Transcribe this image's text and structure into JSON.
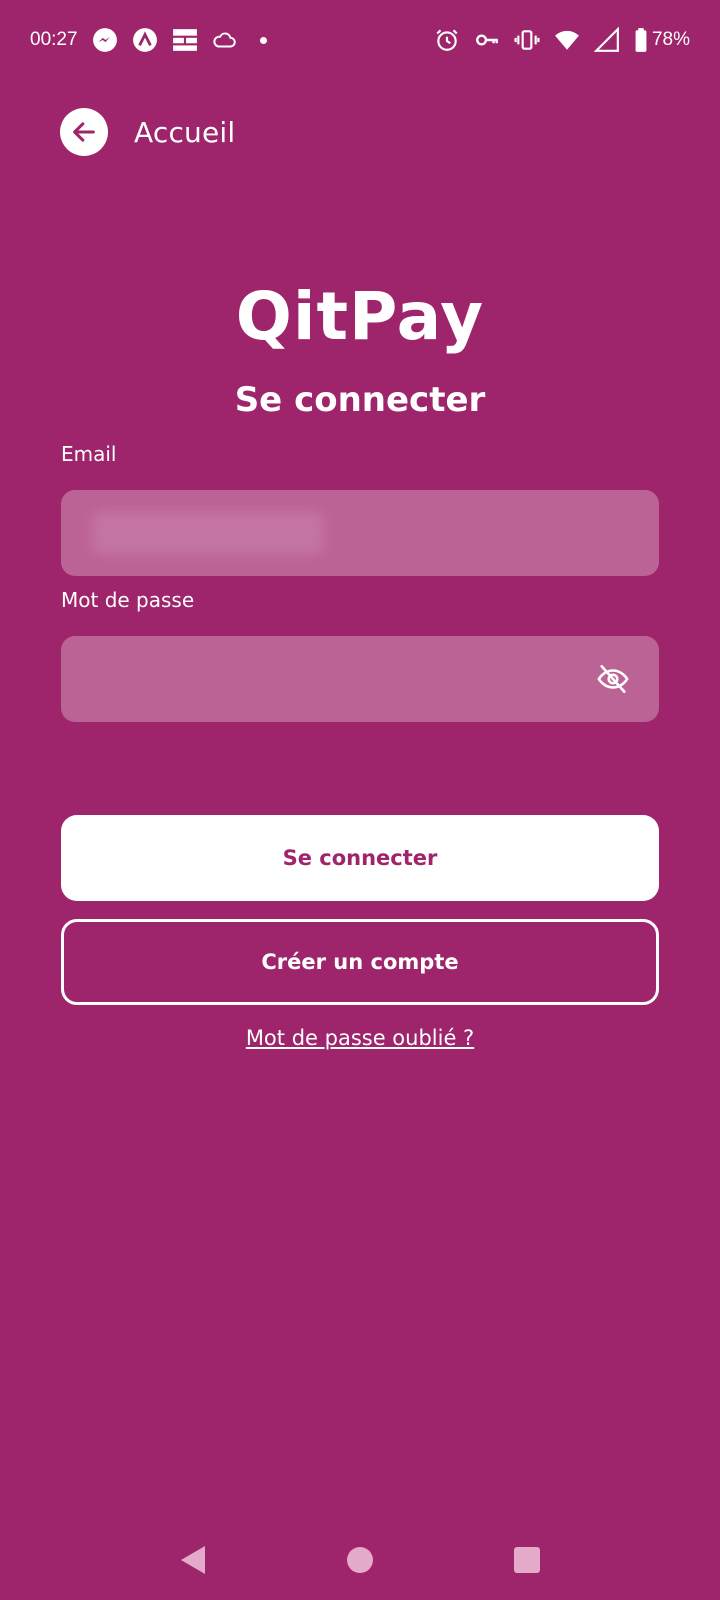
{
  "status_bar": {
    "time": "00:27",
    "battery": "78%",
    "left_icons": [
      "messenger-icon",
      "app-a-icon",
      "grid-icon",
      "cloud-icon"
    ],
    "right_icons": [
      "alarm-icon",
      "vpn-key-icon",
      "vibrate-icon",
      "wifi-icon",
      "signal-icon",
      "battery-icon"
    ]
  },
  "header": {
    "back_label": "Accueil"
  },
  "brand": {
    "logo_text": "QitPay",
    "subtitle": "Se connecter"
  },
  "form": {
    "email_label": "Email",
    "email_value": "",
    "password_label": "Mot de passe",
    "password_value": ""
  },
  "actions": {
    "login_label": "Se connecter",
    "create_account_label": "Créer un compte",
    "forgot_password_label": "Mot de passe oublié ?"
  },
  "colors": {
    "background": "#9e256b",
    "input_fill": "#bc6395",
    "text": "#ffffff"
  }
}
